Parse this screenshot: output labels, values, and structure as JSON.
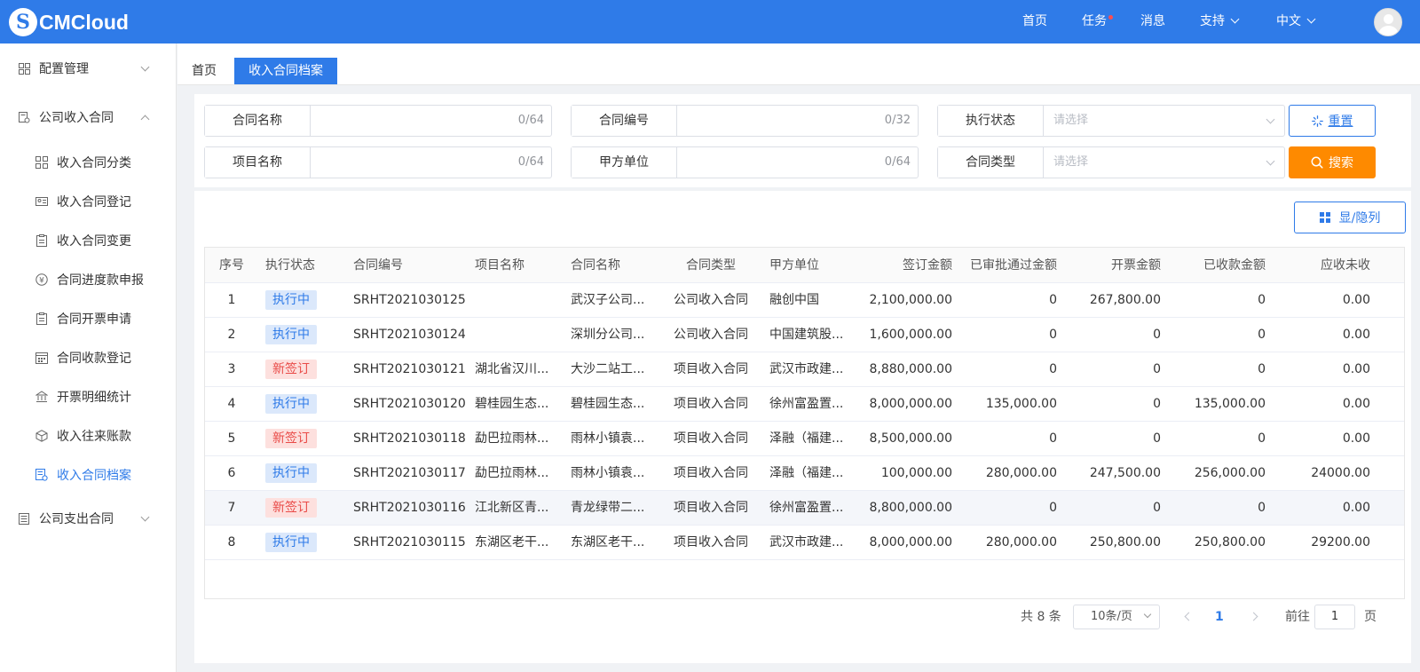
{
  "header": {
    "logo_text": "CMCloud",
    "logo_mark": "S",
    "nav": {
      "home": "首页",
      "tasks": "任务",
      "messages": "消息",
      "support": "支持",
      "language": "中文"
    }
  },
  "sidebar": {
    "groups": [
      {
        "label": "配置管理",
        "icon": "grid-icon",
        "expanded": false
      },
      {
        "label": "公司收入合同",
        "icon": "doc-setting-icon",
        "expanded": true
      },
      {
        "label": "公司支出合同",
        "icon": "doc-icon",
        "expanded": false
      }
    ],
    "items": [
      {
        "label": "收入合同分类",
        "icon": "grid-icon"
      },
      {
        "label": "收入合同登记",
        "icon": "id-card-icon"
      },
      {
        "label": "收入合同变更",
        "icon": "clipboard-icon"
      },
      {
        "label": "合同进度款申报",
        "icon": "yen-circle-icon"
      },
      {
        "label": "合同开票申请",
        "icon": "clipboard-icon"
      },
      {
        "label": "合同收款登记",
        "icon": "calendar-icon"
      },
      {
        "label": "开票明细统计",
        "icon": "bank-icon"
      },
      {
        "label": "收入往来账款",
        "icon": "box-icon"
      },
      {
        "label": "收入合同档案",
        "icon": "archive-icon",
        "active": true
      }
    ]
  },
  "tabs": [
    {
      "label": "首页",
      "active": false
    },
    {
      "label": "收入合同档案",
      "active": true
    }
  ],
  "filters": {
    "contract_name": {
      "label": "合同名称",
      "count": "0/64"
    },
    "contract_code": {
      "label": "合同编号",
      "count": "0/32"
    },
    "exec_status": {
      "label": "执行状态",
      "placeholder": "请选择"
    },
    "project_name": {
      "label": "项目名称",
      "count": "0/64"
    },
    "party_a": {
      "label": "甲方单位",
      "count": "0/64"
    },
    "contract_type": {
      "label": "合同类型",
      "placeholder": "请选择"
    },
    "reset_label": "重置",
    "search_label": "搜索"
  },
  "toolbar": {
    "columns_label": "显/隐列"
  },
  "table": {
    "columns": [
      "序号",
      "执行状态",
      "合同编号",
      "项目名称",
      "合同名称",
      "合同类型",
      "甲方单位",
      "签订金额",
      "已审批通过金额",
      "开票金额",
      "已收款金额",
      "应收未收"
    ],
    "rows": [
      {
        "no": "1",
        "status": "执行中",
        "status_kind": "run",
        "code": "SRHT2021030125",
        "project": "",
        "name": "武汉子公司...",
        "type": "公司收入合同",
        "party": "融创中国",
        "sign": "2,100,000.00",
        "approved": "0",
        "invoiced": "267,800.00",
        "received": "0",
        "due": "0.00"
      },
      {
        "no": "2",
        "status": "执行中",
        "status_kind": "run",
        "code": "SRHT2021030124",
        "project": "",
        "name": "深圳分公司...",
        "type": "公司收入合同",
        "party": "中国建筑股...",
        "sign": "1,600,000.00",
        "approved": "0",
        "invoiced": "0",
        "received": "0",
        "due": "0.00"
      },
      {
        "no": "3",
        "status": "新签订",
        "status_kind": "new",
        "code": "SRHT2021030121",
        "project": "湖北省汉川...",
        "name": "大沙二站工...",
        "type": "项目收入合同",
        "party": "武汉市政建...",
        "sign": "8,880,000.00",
        "approved": "0",
        "invoiced": "0",
        "received": "0",
        "due": "0.00"
      },
      {
        "no": "4",
        "status": "执行中",
        "status_kind": "run",
        "code": "SRHT2021030120",
        "project": "碧桂园生态...",
        "name": "碧桂园生态...",
        "type": "项目收入合同",
        "party": "徐州富盈置...",
        "sign": "8,000,000.00",
        "approved": "135,000.00",
        "invoiced": "0",
        "received": "135,000.00",
        "due": "0.00"
      },
      {
        "no": "5",
        "status": "新签订",
        "status_kind": "new",
        "code": "SRHT2021030118",
        "project": "勐巴拉雨林...",
        "name": "雨林小镇袁...",
        "type": "项目收入合同",
        "party": "泽融（福建...",
        "sign": "8,500,000.00",
        "approved": "0",
        "invoiced": "0",
        "received": "0",
        "due": "0.00"
      },
      {
        "no": "6",
        "status": "执行中",
        "status_kind": "run",
        "code": "SRHT2021030117",
        "project": "勐巴拉雨林...",
        "name": "雨林小镇袁...",
        "type": "项目收入合同",
        "party": "泽融（福建...",
        "sign": "100,000.00",
        "approved": "280,000.00",
        "invoiced": "247,500.00",
        "received": "256,000.00",
        "due": "24000.00"
      },
      {
        "no": "7",
        "status": "新签订",
        "status_kind": "new",
        "code": "SRHT2021030116",
        "project": "江北新区青...",
        "name": "青龙绿带二...",
        "type": "项目收入合同",
        "party": "徐州富盈置...",
        "sign": "8,800,000.00",
        "approved": "0",
        "invoiced": "0",
        "received": "0",
        "due": "0.00",
        "highlight": true
      },
      {
        "no": "8",
        "status": "执行中",
        "status_kind": "run",
        "code": "SRHT2021030115",
        "project": "东湖区老干...",
        "name": "东湖区老干...",
        "type": "项目收入合同",
        "party": "武汉市政建...",
        "sign": "8,000,000.00",
        "approved": "280,000.00",
        "invoiced": "250,800.00",
        "received": "250,800.00",
        "due": "29200.00"
      }
    ]
  },
  "pagination": {
    "total": "共 8 条",
    "page_size": "10条/页",
    "current": "1",
    "goto_label": "前往",
    "goto_value": "1",
    "page_suffix": "页"
  },
  "colors": {
    "primary": "#2f7be8",
    "search": "#fe8a00",
    "tag_new": "#e94b48"
  }
}
